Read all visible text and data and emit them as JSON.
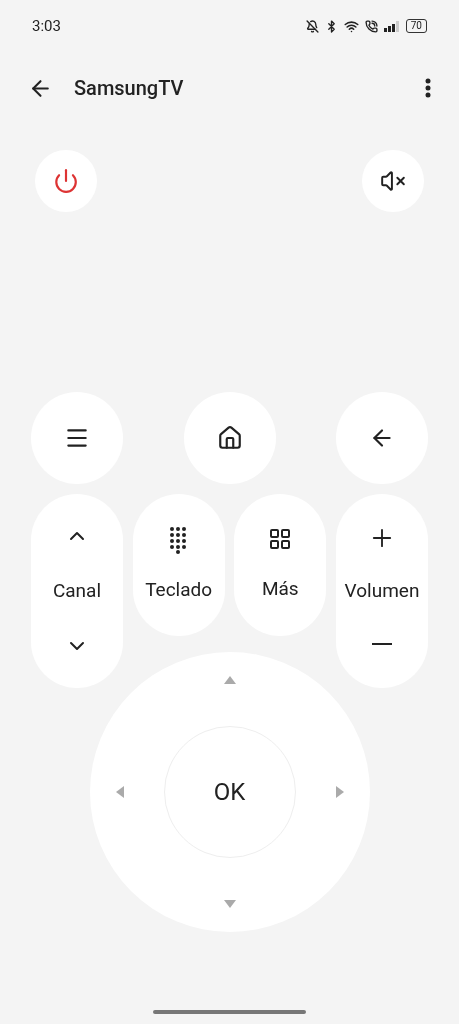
{
  "status_bar": {
    "time": "3:03",
    "battery": "70"
  },
  "header": {
    "title": "SamsungTV"
  },
  "remote": {
    "channel_label": "Canal",
    "keypad_label": "Teclado",
    "more_label": "Más",
    "volume_label": "Volumen",
    "ok_label": "OK"
  }
}
